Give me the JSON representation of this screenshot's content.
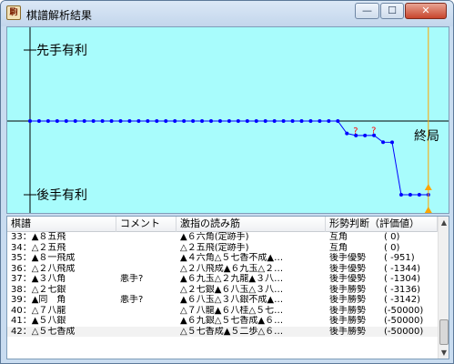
{
  "window": {
    "title": "棋譜解析結果",
    "app_icon": "駒",
    "minimize_label": "—",
    "maximize_label": "☐",
    "close_label": "✕"
  },
  "graph": {
    "top_label": "先手有利",
    "bottom_label": "後手有利",
    "end_label": "終局",
    "colors": {
      "background": "#a8fcfc",
      "line": "#0000ff",
      "bad_move_marker": "#ff0000",
      "cursor": "#ffa500"
    }
  },
  "chart_data": {
    "type": "line",
    "series": [
      {
        "values": [
          0,
          0,
          0,
          0,
          0,
          0,
          0,
          0,
          0,
          0,
          0,
          0,
          0,
          0,
          0,
          0,
          0,
          0,
          0,
          0,
          0,
          0,
          0,
          0,
          0,
          0,
          0,
          0,
          0,
          0,
          0,
          0,
          0,
          0,
          0,
          -951,
          -1344,
          -1344,
          -1304,
          -3136,
          -3142,
          -50000,
          -50000,
          -50000,
          -50000
        ]
      }
    ],
    "ylim": [
      -50000,
      50000
    ],
    "grid": false
  },
  "table": {
    "headers": [
      "棋譜",
      "コメント",
      "激指の読み筋",
      "形勢判断（評価値）"
    ],
    "rows": [
      {
        "move": "33：▲８五飛",
        "comment": "",
        "pv": "▲６六角(定跡手)",
        "judgement": "互角",
        "score": "(      0)"
      },
      {
        "move": "34：△２五飛",
        "comment": "",
        "pv": "△２五飛(定跡手)",
        "judgement": "互角",
        "score": "(      0)"
      },
      {
        "move": "35：▲８一飛成",
        "comment": "",
        "pv": "▲４六角△５七香不成▲…",
        "judgement": "後手優勢",
        "score": "( -951)"
      },
      {
        "move": "36：△２八飛成",
        "comment": "",
        "pv": "△２八飛成▲６九玉△２…",
        "judgement": "後手優勢",
        "score": "( -1344)"
      },
      {
        "move": "37：▲３八角",
        "comment": "悪手?",
        "pv": "▲６九玉△２九龍▲３八…",
        "judgement": "後手優勢",
        "score": "( -1304)"
      },
      {
        "move": "38：△２七銀",
        "comment": "",
        "pv": "△２七銀▲６八玉△３八…",
        "judgement": "後手勝勢",
        "score": "( -3136)"
      },
      {
        "move": "39：▲同　角",
        "comment": "悪手?",
        "pv": "▲６八玉△３八銀不成▲…",
        "judgement": "後手勝勢",
        "score": "( -3142)"
      },
      {
        "move": "40：△７八龍",
        "comment": "",
        "pv": "△７八龍▲６八桂△５七…",
        "judgement": "後手勝勢",
        "score": "(-50000)"
      },
      {
        "move": "41：▲５八銀",
        "comment": "",
        "pv": "▲６九銀△５七香成▲６…",
        "judgement": "後手勝勢",
        "score": "(-50000)"
      },
      {
        "move": "42：△５七香成",
        "comment": "",
        "pv": "△５七香成▲５二歩△６…",
        "judgement": "後手勝勢",
        "score": "(-50000)"
      }
    ]
  }
}
